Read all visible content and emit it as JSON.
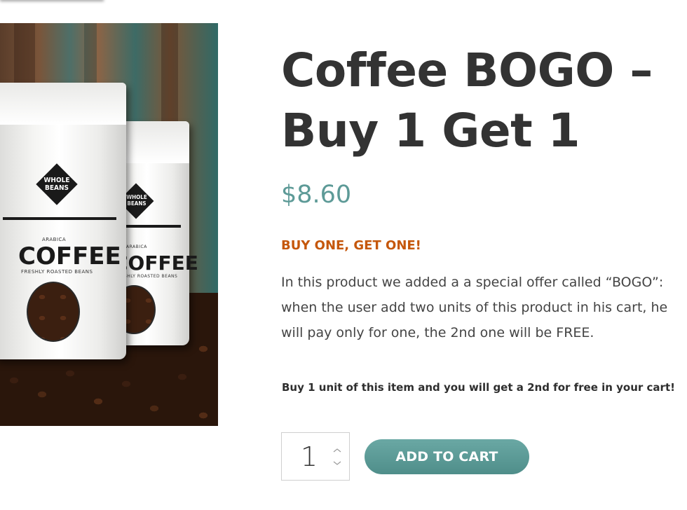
{
  "product": {
    "image_alt": "Whole Beans Arabica Coffee bags",
    "bag_brand": "WHOLE BEANS",
    "bag_variety": "ARABICA",
    "bag_name": "COFFEE",
    "bag_tagline": "FRESHLY ROASTED BEANS",
    "title": "Coffee BOGO – Buy 1 Get 1",
    "price": "$8.60",
    "promo_heading": "BUY ONE, GET ONE!",
    "description": "In this product we added a a special offer called “BOGO”: when the user add two units of this product in his cart, he will pay only for one, the 2nd one will be FREE.",
    "bogo_note": "Buy 1 unit of this item and you will get a 2nd for free in your cart!"
  },
  "cart": {
    "quantity": "1",
    "add_to_cart_label": "ADD TO CART"
  },
  "colors": {
    "price": "#5d9a97",
    "promo": "#c5570b",
    "button": "#5f9c98",
    "title": "#333333"
  }
}
